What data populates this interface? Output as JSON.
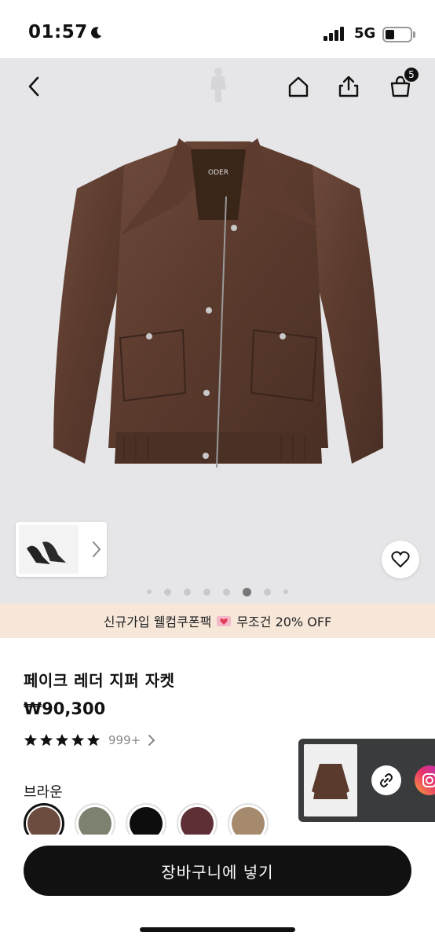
{
  "status_bar": {
    "time": "01:57",
    "network": "5G",
    "icons": [
      "moon-icon",
      "signal-icon",
      "battery-icon"
    ]
  },
  "header": {
    "icons": [
      "back-icon",
      "home-icon",
      "share-icon",
      "cart-icon"
    ],
    "cart_count": "5"
  },
  "gallery": {
    "dot_count": 8,
    "active_index": 5
  },
  "promo": {
    "text_before": "신규가입 웰컴쿠폰팩",
    "text_after": "무조건 20% OFF",
    "icon": "heart-letter-icon"
  },
  "product": {
    "brand_label": "ODER",
    "title": "페이크 레더 지퍼 자켓",
    "price": "₩90,300",
    "rating_stars": 5,
    "review_count": "999+",
    "color_label": "브라운",
    "colors": [
      {
        "name": "brown",
        "hex": "#6b4c3f",
        "selected": true
      },
      {
        "name": "khaki",
        "hex": "#7b8270",
        "selected": false
      },
      {
        "name": "black",
        "hex": "#0d0d0d",
        "selected": false
      },
      {
        "name": "burgundy",
        "hex": "#5e2f35",
        "selected": false
      },
      {
        "name": "camel",
        "hex": "#a58a6e",
        "selected": false
      }
    ]
  },
  "share_panel": {
    "icons": [
      "link-icon",
      "instagram-icon"
    ]
  },
  "cta": {
    "label": "장바구니에 넣기"
  },
  "colors": {
    "promo_bg": "#f6e7d9",
    "hero_bg": "#e6e6e8",
    "cta_bg": "#111111"
  }
}
